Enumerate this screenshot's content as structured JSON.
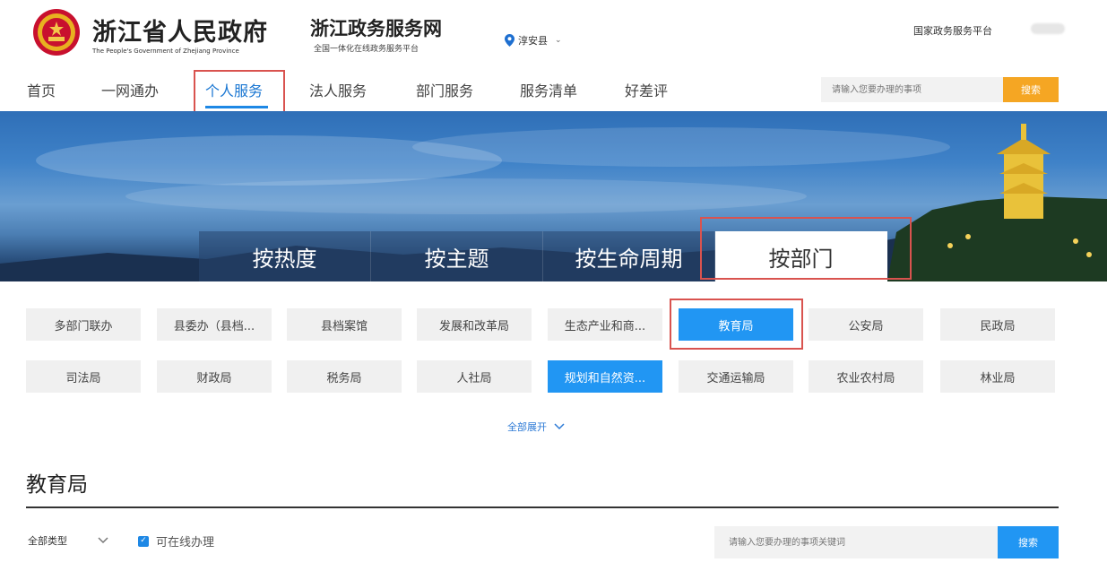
{
  "header": {
    "gov_title": "浙江省人民政府",
    "gov_subtitle": "The People's Government of Zhejiang Province",
    "service_title": "浙江政务服务网",
    "service_subtitle": "全国一体化在线政务服务平台",
    "location": "淳安县",
    "national_link": "国家政务服务平台"
  },
  "nav": {
    "items": [
      "首页",
      "一网通办",
      "个人服务",
      "法人服务",
      "部门服务",
      "服务清单",
      "好差评"
    ],
    "active": "个人服务",
    "search_placeholder": "请输入您要办理的事项",
    "search_button": "搜索"
  },
  "banner": {
    "tabs": [
      "按热度",
      "按主题",
      "按生命周期",
      "按部门"
    ],
    "active_tab": "按部门"
  },
  "departments": {
    "row1": [
      "多部门联办",
      "县委办（县档...",
      "县档案馆",
      "发展和改革局",
      "生态产业和商...",
      "教育局",
      "公安局",
      "民政局"
    ],
    "row2": [
      "司法局",
      "财政局",
      "税务局",
      "人社局",
      "规划和自然资...",
      "交通运输局",
      "农业农村局",
      "林业局"
    ],
    "active": [
      "教育局",
      "规划和自然资..."
    ],
    "expand_label": "全部展开"
  },
  "section": {
    "title": "教育局",
    "filter_type": "全部类型",
    "online_label": "可在线办理",
    "online_checked": true,
    "search_placeholder": "请输入您要办理的事项关键词",
    "search_button": "搜索"
  },
  "colors": {
    "primary_blue": "#2196f3",
    "search_orange": "#f5a623",
    "highlight_red": "#d9534f"
  }
}
